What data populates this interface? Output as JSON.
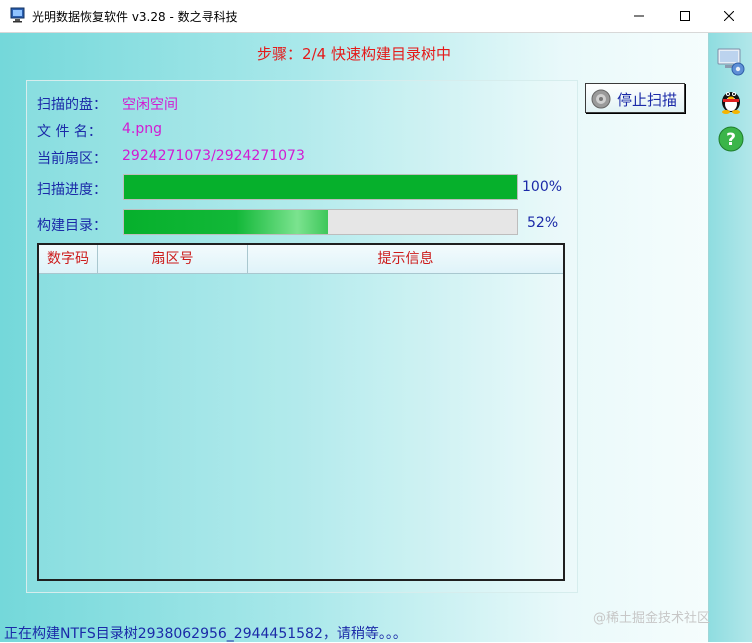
{
  "window": {
    "title": "光明数据恢复软件 v3.28 - 数之寻科技"
  },
  "step_text": "步骤：2/4 快速构建目录树中",
  "info": {
    "disk_label": "扫描的盘：",
    "disk_value": "空闲空间",
    "file_label": "文 件 名：",
    "file_value": "4.png",
    "sector_label": "当前扇区：",
    "sector_value": "2924271073/2924271073"
  },
  "progress": {
    "scan_label": "扫描进度：",
    "scan_value": 1.0,
    "scan_text": "100%",
    "build_label": "构建目录：",
    "build_value": 0.52,
    "build_text": "52%"
  },
  "table": {
    "columns": [
      "数字码",
      "扇区号",
      "提示信息"
    ],
    "rows": []
  },
  "stop_button": {
    "label": "停止扫描",
    "icon": "disc-icon"
  },
  "side_icons": [
    "computer-settings-icon",
    "qq-penguin-icon",
    "help-icon"
  ],
  "status_text": "正在构建NTFS目录树2938062956_2944451582，请稍等。。。",
  "watermark": "@稀土掘金技术社区",
  "colors": {
    "label": "#1b2aa8",
    "value": "#d21bd2",
    "step": "#e41a1a",
    "progress": "#06b02c",
    "header_text": "#cc1b1b"
  }
}
